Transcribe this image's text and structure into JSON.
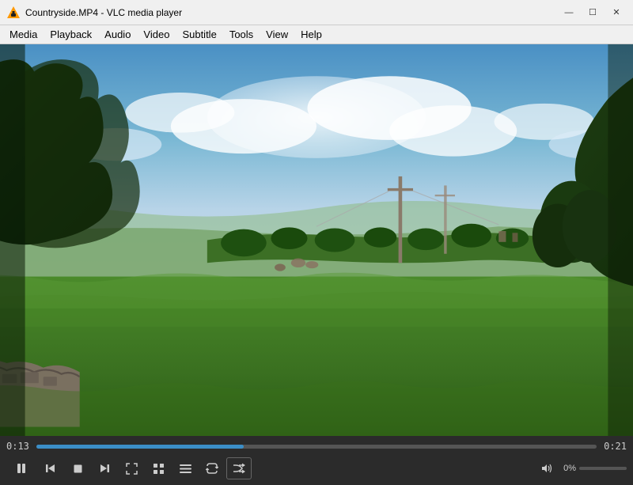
{
  "titlebar": {
    "title": "Countryside.MP4 - VLC media player",
    "minimize_label": "—",
    "maximize_label": "☐",
    "close_label": "✕"
  },
  "menubar": {
    "items": [
      {
        "label": "Media"
      },
      {
        "label": "Playback"
      },
      {
        "label": "Audio"
      },
      {
        "label": "Video"
      },
      {
        "label": "Subtitle"
      },
      {
        "label": "Tools"
      },
      {
        "label": "View"
      },
      {
        "label": "Help"
      }
    ]
  },
  "progress": {
    "current_time": "0:13",
    "total_time": "0:21",
    "fill_percent": 37
  },
  "volume": {
    "label": "0%",
    "fill_percent": 0
  },
  "controls": {
    "play_pause": "pause",
    "buttons": [
      {
        "name": "prev-button",
        "icon": "⏮"
      },
      {
        "name": "stop-button",
        "icon": "■"
      },
      {
        "name": "next-button",
        "icon": "⏭"
      },
      {
        "name": "fullscreen-button",
        "icon": "⛶"
      },
      {
        "name": "extended-button",
        "icon": "▨"
      },
      {
        "name": "playlist-button",
        "icon": "≡"
      },
      {
        "name": "loop-button",
        "icon": "↻"
      },
      {
        "name": "random-button",
        "icon": "⇄"
      }
    ]
  }
}
